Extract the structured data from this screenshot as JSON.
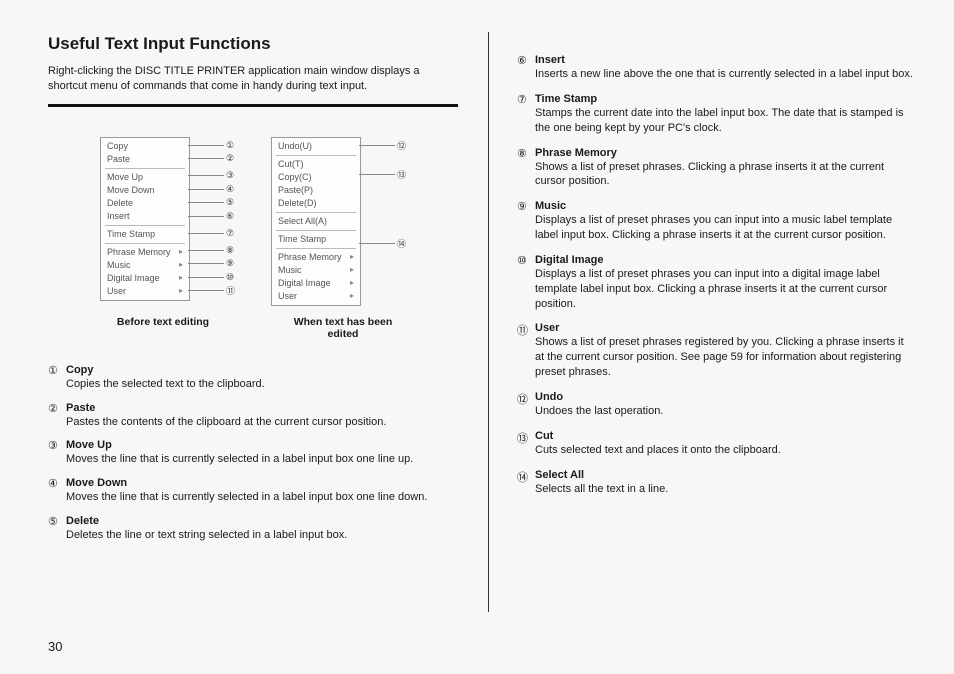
{
  "heading": "Useful Text Input Functions",
  "intro": "Right-clicking the DISC TITLE PRINTER application main window displays a shortcut menu of commands that come in handy during text input.",
  "menuLeft": {
    "groups": [
      [
        "Copy",
        "Paste"
      ],
      [
        "Move Up",
        "Move Down",
        "Delete",
        "Insert"
      ],
      [
        "Time Stamp"
      ],
      [
        "Phrase Memory",
        "Music",
        "Digital Image",
        "User"
      ]
    ]
  },
  "menuRight": {
    "groups": [
      [
        "Undo(U)"
      ],
      [
        "Cut(T)",
        "Copy(C)",
        "Paste(P)",
        "Delete(D)"
      ],
      [
        "Select All(A)"
      ],
      [
        "Time Stamp"
      ],
      [
        "Phrase Memory",
        "Music",
        "Digital Image",
        "User"
      ]
    ]
  },
  "calloutsLeft": [
    "①",
    "②",
    "③",
    "④",
    "⑤",
    "⑥",
    "⑦",
    "⑧",
    "⑨",
    "⑩",
    "⑪"
  ],
  "calloutsRight": [
    "⑫",
    "⑬",
    "⑭"
  ],
  "captionLeft": "Before text editing",
  "captionRight": "When text has been edited",
  "defsLeft": [
    {
      "n": "①",
      "t": "Copy",
      "d": "Copies the selected text to the clipboard."
    },
    {
      "n": "②",
      "t": "Paste",
      "d": "Pastes the contents of the clipboard at the current cursor position."
    },
    {
      "n": "③",
      "t": "Move Up",
      "d": "Moves the line that is currently selected in a label input box one line up."
    },
    {
      "n": "④",
      "t": "Move Down",
      "d": "Moves the line that is currently selected in a label input box one line down."
    },
    {
      "n": "⑤",
      "t": "Delete",
      "d": "Deletes the line or text string selected in a label input box."
    }
  ],
  "defsRight": [
    {
      "n": "⑥",
      "t": "Insert",
      "d": "Inserts a new line above the one that is currently selected in a label input box."
    },
    {
      "n": "⑦",
      "t": "Time Stamp",
      "d": "Stamps the current date into the label input box.\nThe date that is stamped is the one being kept by your PC's clock."
    },
    {
      "n": "⑧",
      "t": "Phrase Memory",
      "d": "Shows a list of preset phrases. Clicking a phrase inserts it at the current cursor position."
    },
    {
      "n": "⑨",
      "t": "Music",
      "d": "Displays a list of preset phrases you can input into a music label template label input box. Clicking a phrase inserts it at the current cursor position."
    },
    {
      "n": "⑩",
      "t": "Digital Image",
      "d": "Displays a list of preset phrases you can input into a digital image label template label input box. Clicking a phrase inserts it at the current cursor position."
    },
    {
      "n": "⑪",
      "t": "User",
      "d": "Shows a list of preset phrases registered by you. Clicking a phrase inserts it at the current cursor position. See page 59 for information about registering preset phrases."
    },
    {
      "n": "⑫",
      "t": "Undo",
      "d": "Undoes the last operation."
    },
    {
      "n": "⑬",
      "t": "Cut",
      "d": "Cuts selected text and places it onto the clipboard."
    },
    {
      "n": "⑭",
      "t": "Select All",
      "d": "Selects all the text in a line."
    }
  ],
  "pageNumber": "30"
}
